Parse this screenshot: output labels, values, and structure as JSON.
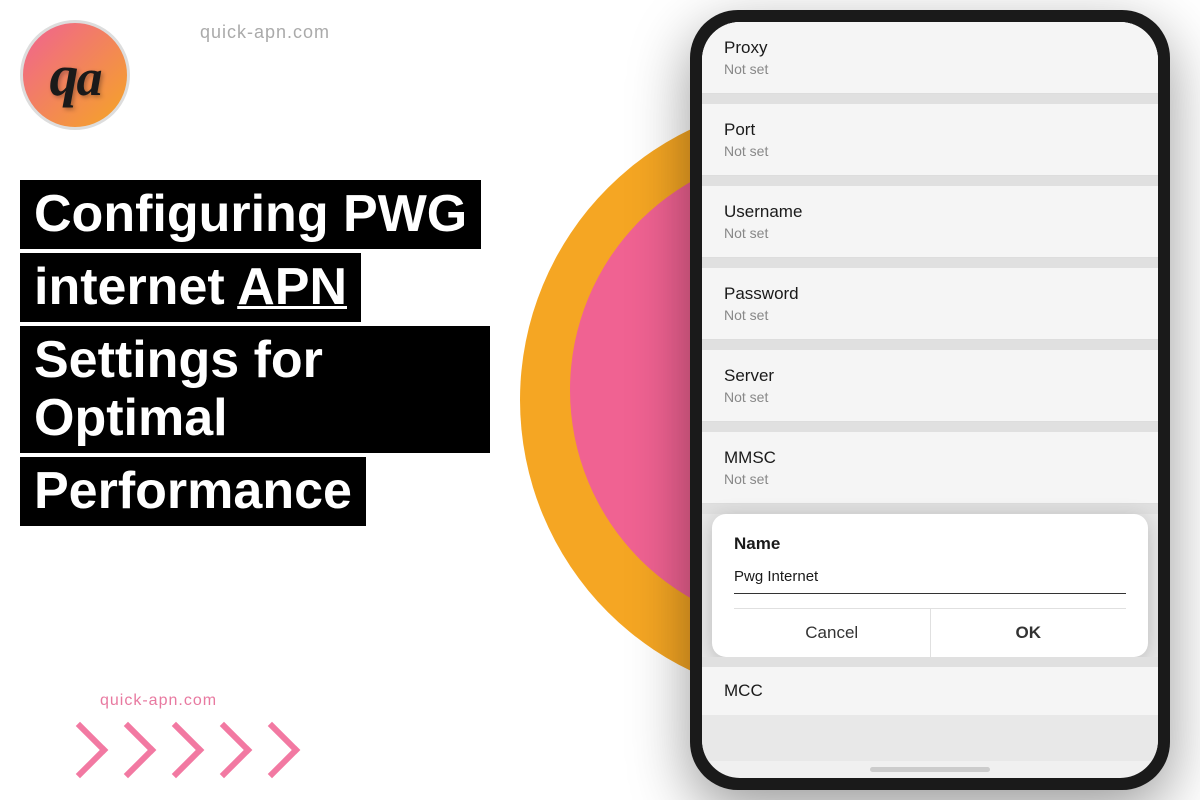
{
  "site": {
    "url_top": "quick-apn.com",
    "url_bottom": "quick-apn.com"
  },
  "logo": {
    "text": "Qa"
  },
  "title": {
    "line1": "Configuring  PWG",
    "line2_part1": "internet ",
    "line2_part2": "APN",
    "line3": "Settings for Optimal",
    "line4": "Performance"
  },
  "phone": {
    "apn_fields": [
      {
        "label": "Proxy",
        "value": "Not set"
      },
      {
        "label": "Port",
        "value": "Not set"
      },
      {
        "label": "Username",
        "value": "Not set"
      },
      {
        "label": "Password",
        "value": "Not set"
      },
      {
        "label": "Server",
        "value": "Not set"
      },
      {
        "label": "MMSC",
        "value": "Not set"
      }
    ],
    "dialog": {
      "title": "Name",
      "input_value": "Pwg Internet",
      "cancel_label": "Cancel",
      "ok_label": "OK"
    },
    "mcc_label": "MCC"
  },
  "colors": {
    "orange": "#f5a623",
    "pink": "#f06292",
    "black": "#000000",
    "white": "#ffffff"
  }
}
